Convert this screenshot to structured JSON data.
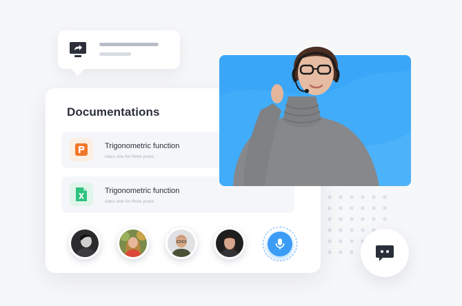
{
  "share_card": {
    "icon": "share-screen-icon"
  },
  "documents": {
    "title": "Documentations",
    "items": [
      {
        "name": "Trigonometric function",
        "subtitle": "class one for three years",
        "icon": "powerpoint-file-icon",
        "color": "#f2772b"
      },
      {
        "name": "Trigonometric function",
        "subtitle": "class one for three years",
        "icon": "excel-file-icon",
        "color": "#2ec27e"
      }
    ]
  },
  "participants": {
    "count": 4,
    "mic_icon": "microphone-icon",
    "accent": "#3a9cf5"
  },
  "video": {
    "background": "#3aa6f7"
  },
  "chat": {
    "icon": "chat-bubble-icon"
  }
}
